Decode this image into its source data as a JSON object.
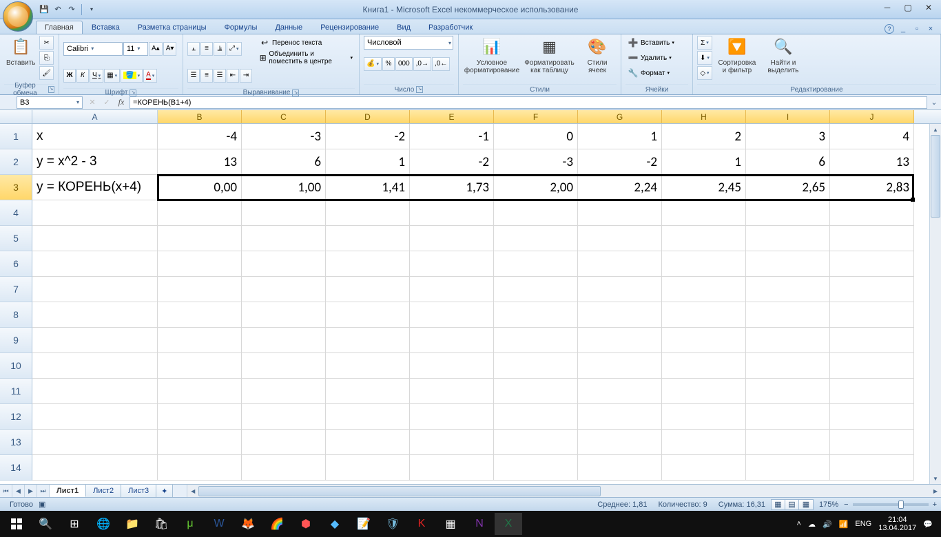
{
  "title": "Книга1 - Microsoft Excel некоммерческое использование",
  "tabs": {
    "home": "Главная",
    "insert": "Вставка",
    "layout": "Разметка страницы",
    "formulas": "Формулы",
    "data": "Данные",
    "review": "Рецензирование",
    "view": "Вид",
    "developer": "Разработчик"
  },
  "ribbon": {
    "clipboard": {
      "paste": "Вставить",
      "label": "Буфер обмена"
    },
    "font": {
      "name": "Calibri",
      "size": "11",
      "label": "Шрифт",
      "bold": "Ж",
      "italic": "К",
      "underline": "Ч"
    },
    "align": {
      "wrap": "Перенос текста",
      "merge": "Объединить и поместить в центре",
      "label": "Выравнивание"
    },
    "number": {
      "format": "Числовой",
      "label": "Число"
    },
    "styles": {
      "cond": "Условное форматирование",
      "table": "Форматировать как таблицу",
      "cell": "Стили ячеек",
      "label": "Стили"
    },
    "cells": {
      "insert": "Вставить",
      "delete": "Удалить",
      "format": "Формат",
      "label": "Ячейки"
    },
    "editing": {
      "sort": "Сортировка и фильтр",
      "find": "Найти и выделить",
      "label": "Редактирование"
    }
  },
  "namebox": "B3",
  "formula": "=КОРЕНЬ(B1+4)",
  "cols": [
    "A",
    "B",
    "C",
    "D",
    "E",
    "F",
    "G",
    "H",
    "I",
    "J"
  ],
  "colw": {
    "A": 182,
    "other": 122
  },
  "data_rows": [
    {
      "h": "1",
      "A": "x",
      "vals": [
        "-4",
        "-3",
        "-2",
        "-1",
        "0",
        "1",
        "2",
        "3",
        "4"
      ]
    },
    {
      "h": "2",
      "A": "y = x^2 - 3",
      "vals": [
        "13",
        "6",
        "1",
        "-2",
        "-3",
        "-2",
        "1",
        "6",
        "13"
      ]
    },
    {
      "h": "3",
      "A": "y = КОРЕНЬ(x+4)",
      "vals": [
        "0,00",
        "1,00",
        "1,41",
        "1,73",
        "2,00",
        "2,24",
        "2,45",
        "2,65",
        "2,83"
      ]
    }
  ],
  "empty_rows": [
    "4",
    "5",
    "6",
    "7",
    "8",
    "9",
    "10",
    "11",
    "12",
    "13",
    "14"
  ],
  "sheets": [
    "Лист1",
    "Лист2",
    "Лист3"
  ],
  "status": {
    "ready": "Готово",
    "avg": "Среднее: 1,81",
    "count": "Количество: 9",
    "sum": "Сумма: 16,31",
    "zoom": "175%"
  },
  "taskbar": {
    "lang": "ENG",
    "time": "21:04",
    "date": "13.04.2017"
  }
}
